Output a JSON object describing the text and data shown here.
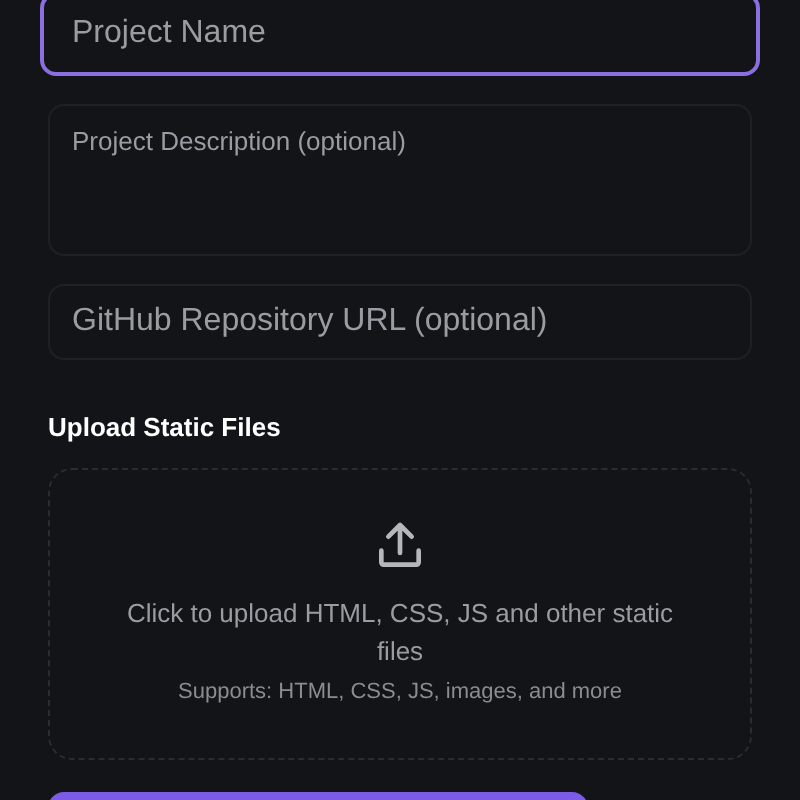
{
  "fields": [
    {
      "kind": "input",
      "placeholder": "Project Name",
      "focused": true
    },
    {
      "kind": "textarea",
      "placeholder": "Project Description (optional)",
      "focused": false
    },
    {
      "kind": "input",
      "placeholder": "GitHub Repository URL (optional)",
      "focused": false
    }
  ],
  "upload": {
    "label": "Upload Static Files",
    "prompt": "Click to upload HTML, CSS, JS and other static files",
    "hint": "Supports: HTML, CSS, JS, images, and more"
  }
}
